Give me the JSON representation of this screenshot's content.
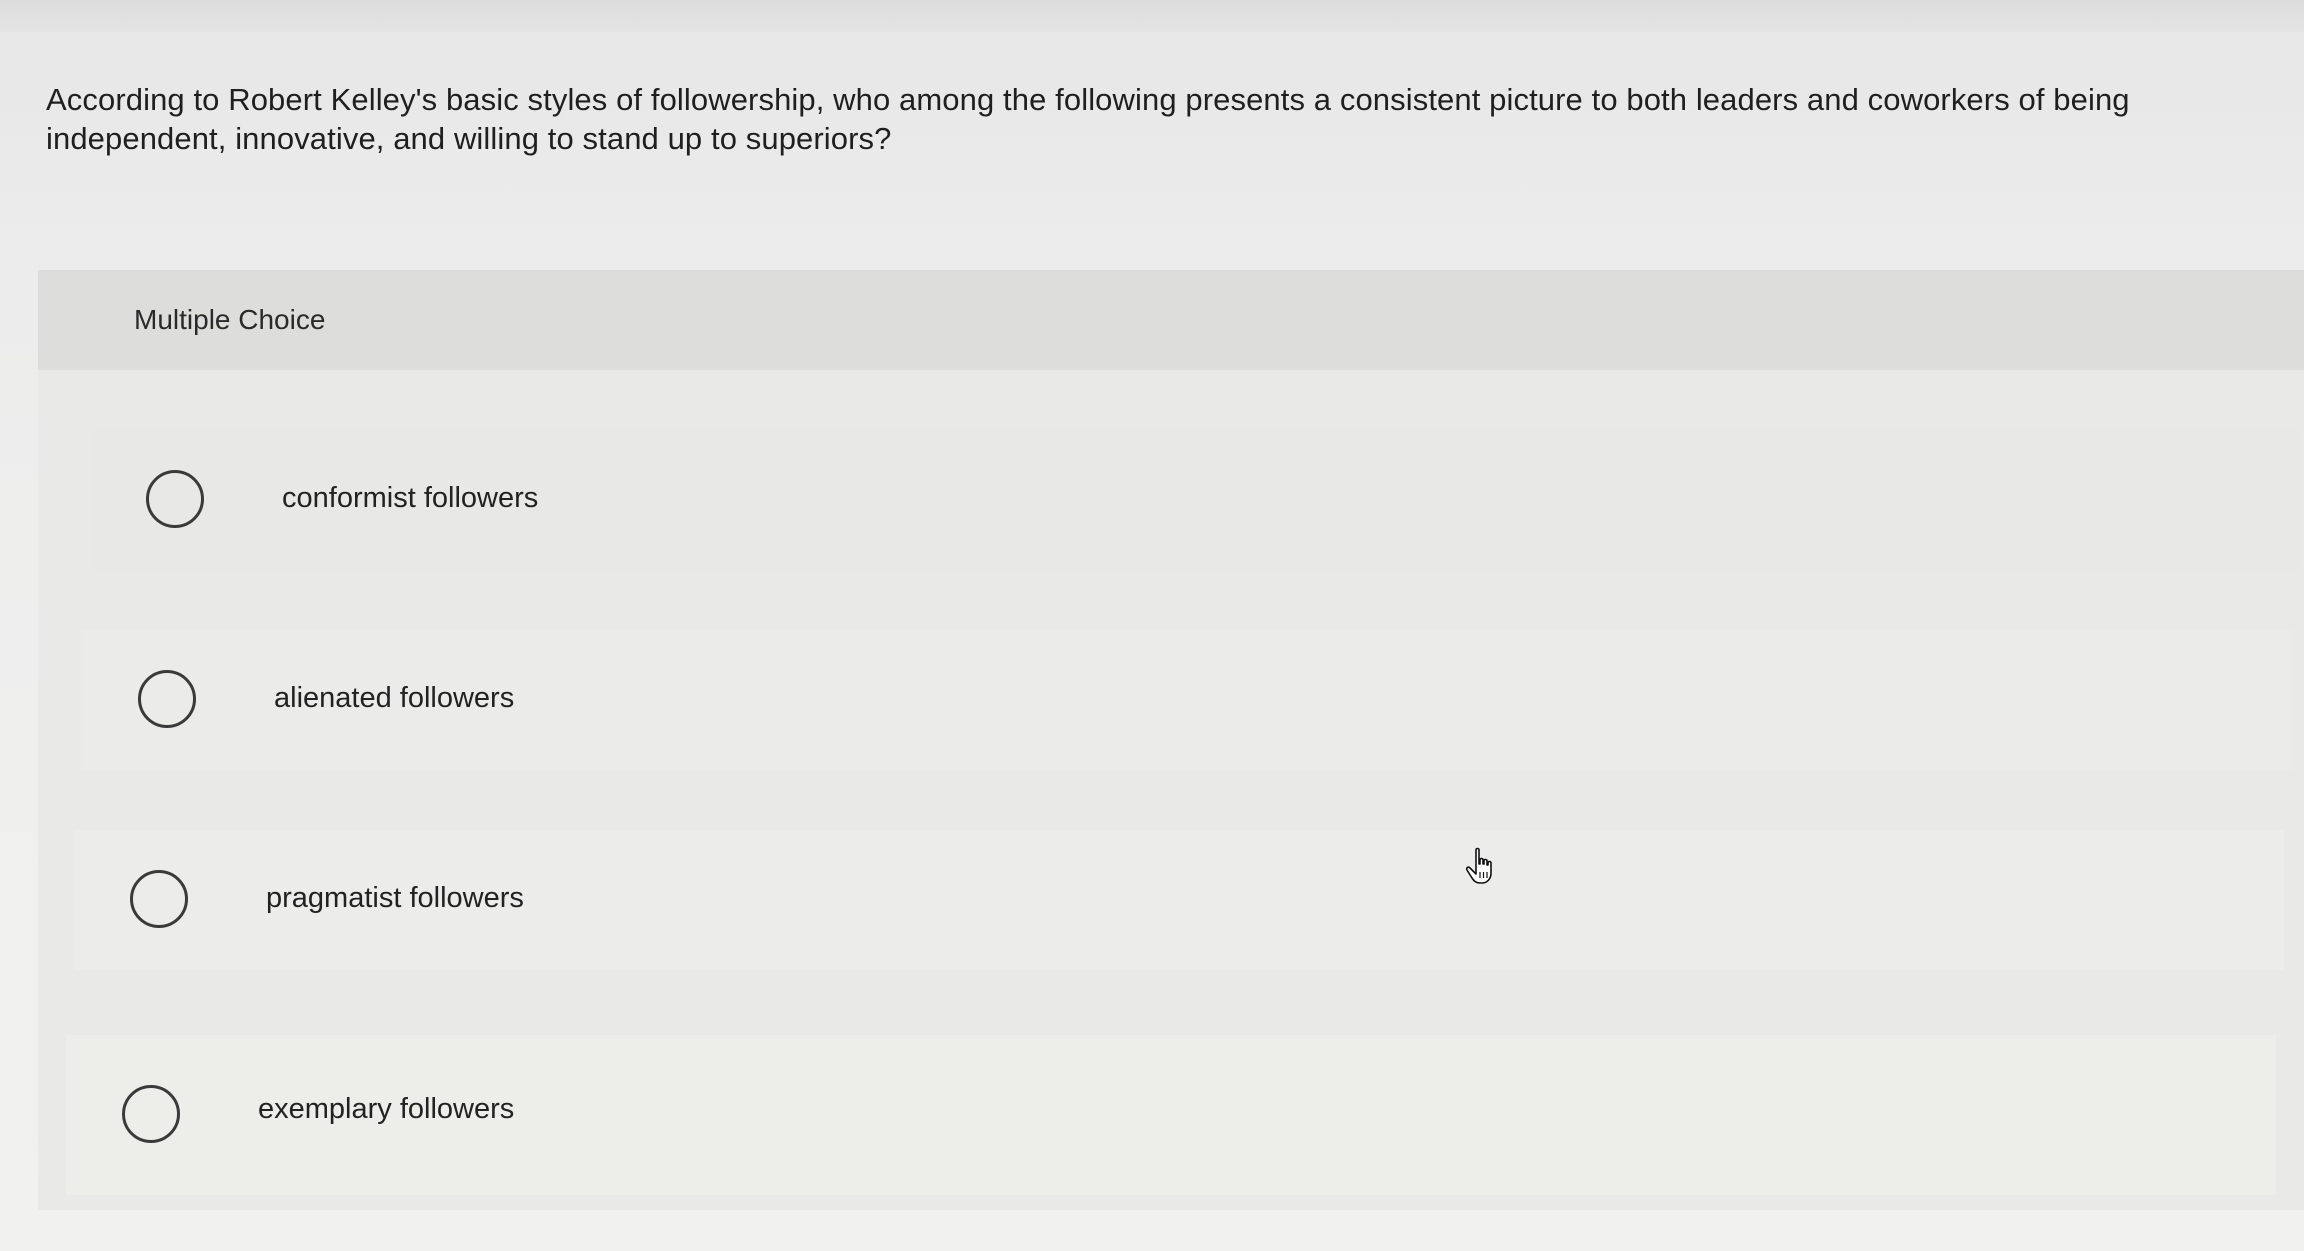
{
  "question": {
    "text": "According to Robert Kelley's basic styles of followership, who among the following presents a consistent picture to both leaders and coworkers of being independent, innovative, and willing to stand up to superiors?"
  },
  "multiple_choice": {
    "header_label": "Multiple Choice",
    "options": [
      {
        "label": "conformist followers",
        "selected": false
      },
      {
        "label": "alienated followers",
        "selected": false
      },
      {
        "label": "pragmatist followers",
        "selected": false
      },
      {
        "label": "exemplary followers",
        "selected": false
      }
    ]
  },
  "cursor": {
    "icon": "hand-pointer-icon"
  }
}
